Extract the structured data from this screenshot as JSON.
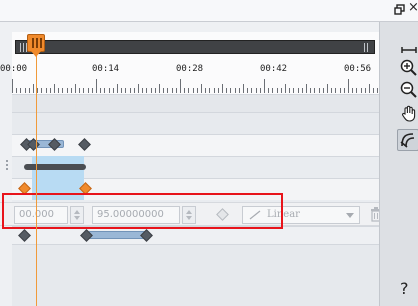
{
  "window": {
    "restore_icon": "restore-icon",
    "close_glyph": "×"
  },
  "ruler": {
    "time_labels": [
      "00:00",
      "00:14",
      "00:28",
      "00:42",
      "00:56"
    ]
  },
  "playhead": {
    "time": "00:00"
  },
  "keyframe_editor": {
    "time_value": "00.000",
    "value_field": "95.00000000",
    "interpolation": "Linear"
  },
  "toolbar": {
    "tools": [
      "fit-width-icon",
      "zoom-in-icon",
      "zoom-out-icon",
      "pan-hand-icon",
      "keyframe-tool-icon"
    ],
    "help_label": "?"
  },
  "colors": {
    "playhead": "#f08a2c",
    "selection_highlight": "#e8141b",
    "selected_range": "#b8dbf3",
    "keyframe_segment": "#9ab7d6"
  }
}
